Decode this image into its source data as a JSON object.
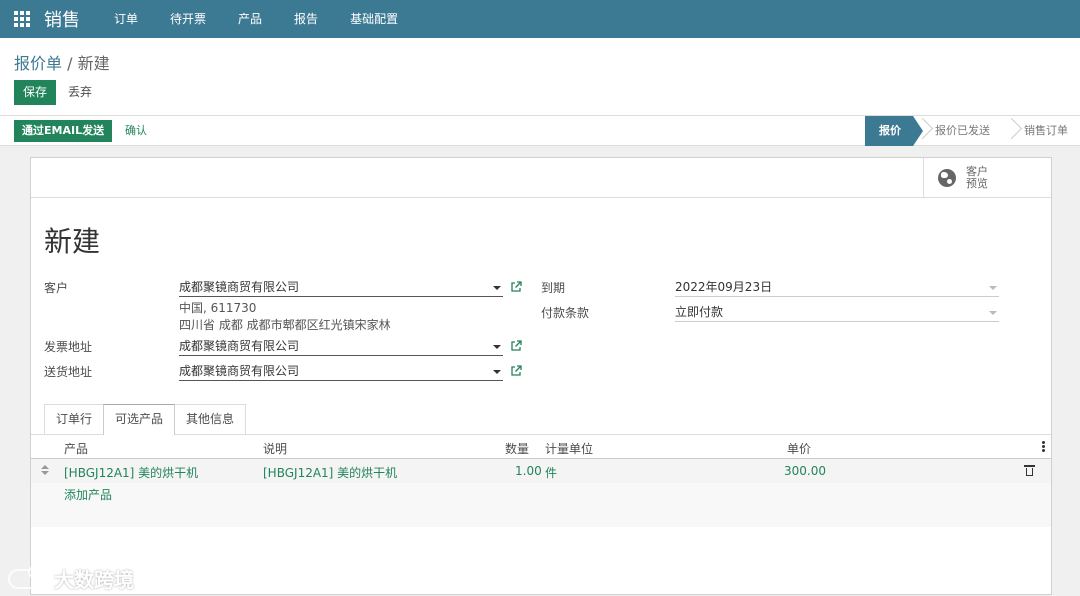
{
  "app": {
    "title": "销售",
    "menu": [
      "订单",
      "待开票",
      "产品",
      "报告",
      "基础配置"
    ]
  },
  "breadcrumb": {
    "parent": "报价单",
    "separator": " / ",
    "current": "新建"
  },
  "control": {
    "save_label": "保存",
    "discard_label": "丢弃"
  },
  "statusbar": {
    "email_label": "通过EMAIL发送",
    "confirm_label": "确认",
    "stages": [
      "报价",
      "报价已发送",
      "销售订单"
    ],
    "active_stage": "报价"
  },
  "sheet": {
    "preview_label": "客户 预览",
    "title": "新建",
    "customer_label": "客户",
    "customer_value": "成都聚镜商贸有限公司",
    "customer_address_line1": "中国, 611730",
    "customer_address_line2": "四川省 成都 成都市郫都区红光镇宋家林",
    "invoice_address_label": "发票地址",
    "invoice_address_value": "成都聚镜商贸有限公司",
    "delivery_address_label": "送货地址",
    "delivery_address_value": "成都聚镜商贸有限公司",
    "expiry_label": "到期",
    "expiry_value": "2022年09月23日",
    "payment_terms_label": "付款条款",
    "payment_terms_value": "立即付款"
  },
  "tabs": [
    "订单行",
    "可选产品",
    "其他信息"
  ],
  "active_tab": "可选产品",
  "table": {
    "headers": {
      "product": "产品",
      "description": "说明",
      "quantity": "数量",
      "uom": "计量单位",
      "unit_price": "单价"
    },
    "rows": [
      {
        "product": "[HBGJ12A1] 美的烘干机",
        "description": "[HBGJ12A1] 美的烘干机",
        "quantity": "1.00",
        "uom": "件",
        "unit_price": "300.00"
      }
    ],
    "add_label": "添加产品"
  },
  "watermark": {
    "text": "大数跨境"
  },
  "colors": {
    "primary": "#3c7a93",
    "success": "#21845b"
  }
}
